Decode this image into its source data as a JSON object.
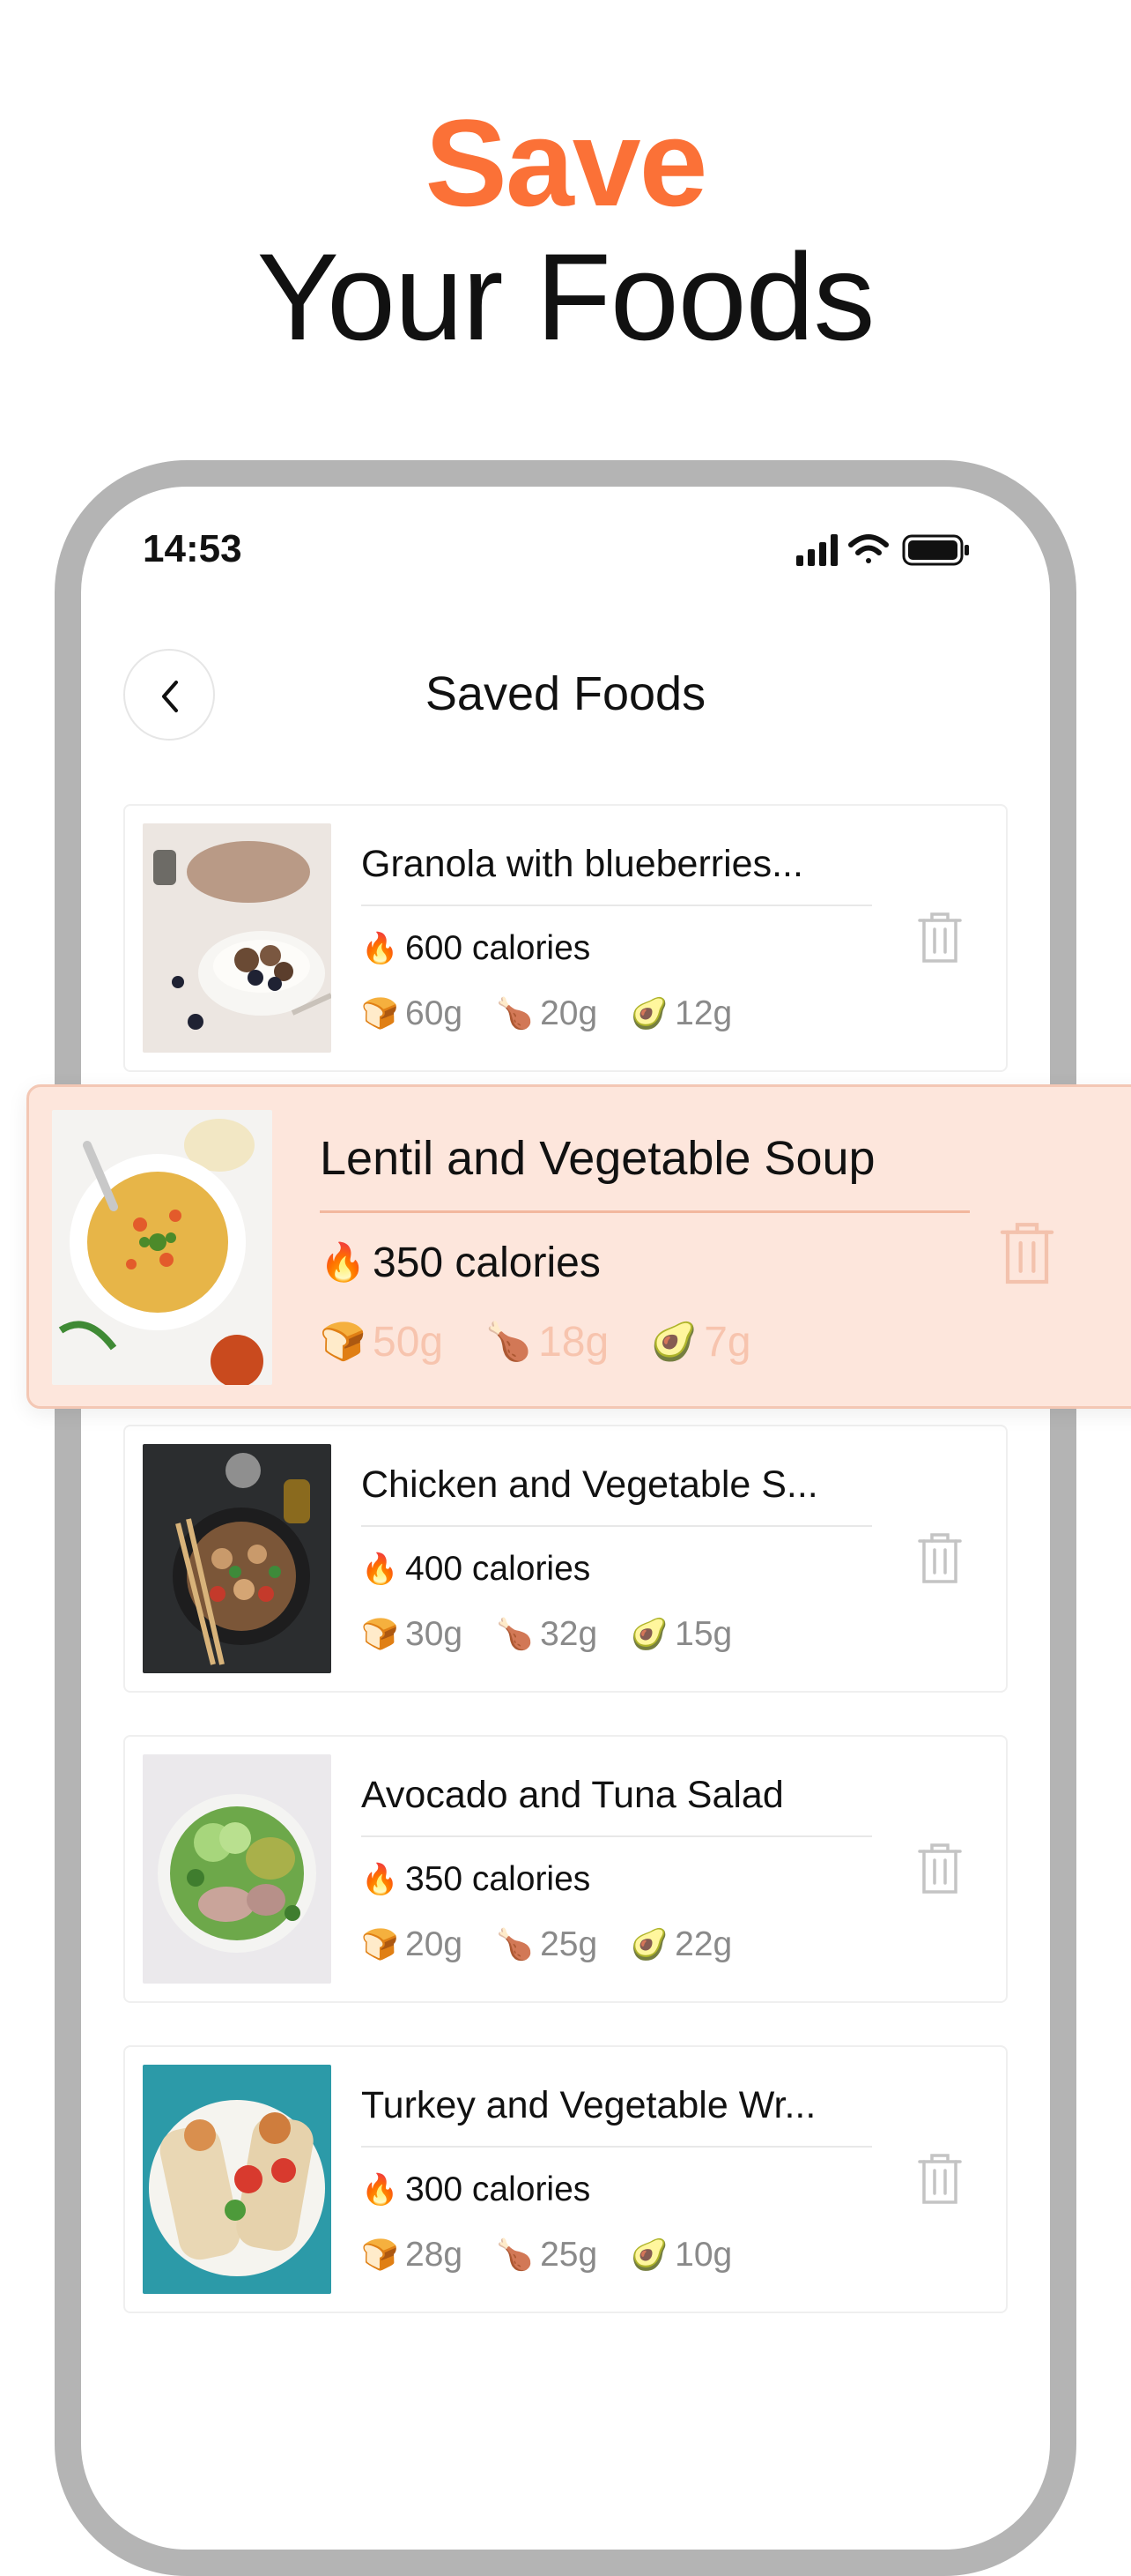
{
  "hero": {
    "accent": "Save",
    "title": "Your Foods"
  },
  "status_bar": {
    "time": "14:53"
  },
  "header": {
    "title": "Saved Foods"
  },
  "colors": {
    "accent": "#fb7137",
    "highlight_bg": "#fde6dc",
    "muted": "#8a8a8a"
  },
  "foods": [
    {
      "name": "Granola with blueberries...",
      "calories": "600 calories",
      "carbs": "60g",
      "protein": "20g",
      "fat": "12g"
    },
    {
      "name": "Lentil and Vegetable Soup",
      "calories": "350 calories",
      "carbs": "50g",
      "protein": "18g",
      "fat": "7g"
    },
    {
      "name": "Chicken and Vegetable S...",
      "calories": "400 calories",
      "carbs": "30g",
      "protein": "32g",
      "fat": "15g"
    },
    {
      "name": "Avocado and Tuna Salad",
      "calories": "350 calories",
      "carbs": "20g",
      "protein": "25g",
      "fat": "22g"
    },
    {
      "name": "Turkey and Vegetable Wr...",
      "calories": "300 calories",
      "carbs": "28g",
      "protein": "25g",
      "fat": "10g"
    }
  ],
  "icons": {
    "calories": "fire-icon",
    "carbs": "bread-icon",
    "protein": "drumstick-icon",
    "fat": "avocado-icon",
    "delete": "trash-icon",
    "back": "chevron-left-icon"
  }
}
